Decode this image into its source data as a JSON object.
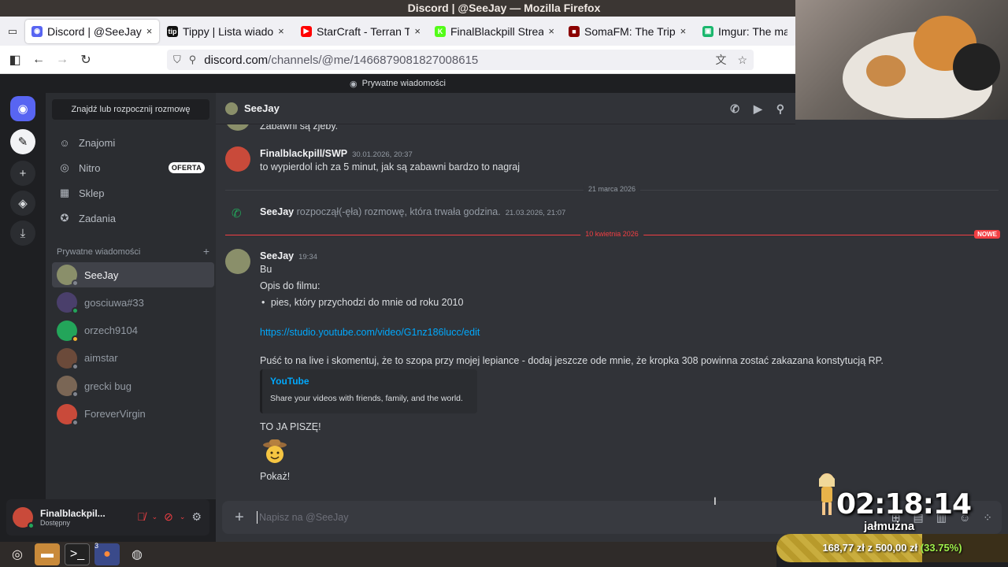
{
  "window": {
    "title": "Discord | @SeeJay — Mozilla Firefox"
  },
  "browser": {
    "tabs": [
      {
        "label": "Discord | @SeeJay",
        "color": "#5865f2",
        "glyph": "◉",
        "active": true,
        "close": "×"
      },
      {
        "label": "Tippy | Lista wiado",
        "color": "#111111",
        "glyph": "tip",
        "active": false,
        "close": "×"
      },
      {
        "label": "StarCraft - Terran T",
        "color": "#ff0000",
        "glyph": "▶",
        "active": false,
        "close": "×"
      },
      {
        "label": "FinalBlackpill Strea",
        "color": "#53fc18",
        "glyph": "K",
        "active": false,
        "close": "×"
      },
      {
        "label": "SomaFM: The Trip",
        "color": "#8b0000",
        "glyph": "■",
        "active": false,
        "close": "×"
      },
      {
        "label": "Imgur: The mag",
        "color": "#1bb76e",
        "glyph": "▣",
        "active": false,
        "close": ""
      }
    ],
    "url_host": "discord.com",
    "url_path": "/channels/@me/1466879081827008615"
  },
  "discord": {
    "topbar": "Prywatne wiadomości",
    "search_label": "Znajdź lub rozpocznij rozmowę",
    "nav": [
      {
        "label": "Znajomi",
        "icon": "friends-icon",
        "glyph": "☺"
      },
      {
        "label": "Nitro",
        "icon": "nitro-icon",
        "glyph": "◎",
        "badge": "OFERTA"
      },
      {
        "label": "Sklep",
        "icon": "shop-icon",
        "glyph": "▦"
      },
      {
        "label": "Zadania",
        "icon": "quests-icon",
        "glyph": "✪"
      }
    ],
    "dm_section_label": "Prywatne wiadomości",
    "dm_add": "+",
    "dms": [
      {
        "name": "SeeJay",
        "color": "#8a8f6a",
        "status": "#80848e",
        "active": true
      },
      {
        "name": "gosciuwa#33",
        "color": "#4a3f6b",
        "status": "#23a55a",
        "active": false
      },
      {
        "name": "orzech9104",
        "color": "#23a55a",
        "status": "#f0b232",
        "active": false
      },
      {
        "name": "aimstar",
        "color": "#6b4a3a",
        "status": "#80848e",
        "active": false
      },
      {
        "name": "grecki bug",
        "color": "#7a6655",
        "status": "#80848e",
        "active": false
      },
      {
        "name": "ForeverVirgin",
        "color": "#c94a3a",
        "status": "#80848e",
        "active": false
      }
    ],
    "user": {
      "name": "Finalblackpil...",
      "status": "Dostępny"
    },
    "chat": {
      "title": "SeeJay",
      "top_cut": "Zabawni są  zjeby.",
      "msg1": {
        "author": "Finalblackpill/SWP",
        "time": "30.01.2026, 20:37",
        "text": "to wypierdol ich za 5 minut, jak są zabawni bardzo to nagraj"
      },
      "date1": "21 marca 2026",
      "call": {
        "author": "SeeJay",
        "text": "rozpoczął(-ęła) rozmowę, która trwała godzina.",
        "time": "21.03.2026, 21:07"
      },
      "date2": "10 kwietnia 2026",
      "new_label": "NOWE",
      "msg2": {
        "author": "SeeJay",
        "time": "19:34",
        "l1": "Bu",
        "l2": "Opis do filmu:",
        "l3": "pies, który przychodzi do mnie od roku 2010",
        "link": "https://studio.youtube.com/video/G1nz186lucc/edit",
        "l5": "Puść to na live i skomentuj, że to szopa przy mojej lepiance - dodaj jeszcze ode mnie, że kropka 308 powinna zostać zakazana konstytucją RP.",
        "embed_title": "YouTube",
        "embed_desc": "Share your videos with friends, family, and the world.",
        "l6": "TO JA PISZĘ!",
        "l7": "Pokaż!"
      },
      "composer_placeholder": "Napisz na @SeeJay"
    }
  },
  "overlay": {
    "timer": "02:18:14",
    "timer_sub": "jałmużna",
    "donate_current": "168,77 zł",
    "donate_sep": "z",
    "donate_goal": "500,00 zł",
    "donate_pct": "(33.75%)",
    "donate_fraction": 0.3375
  },
  "taskbar": {
    "firefox_count": "3"
  }
}
